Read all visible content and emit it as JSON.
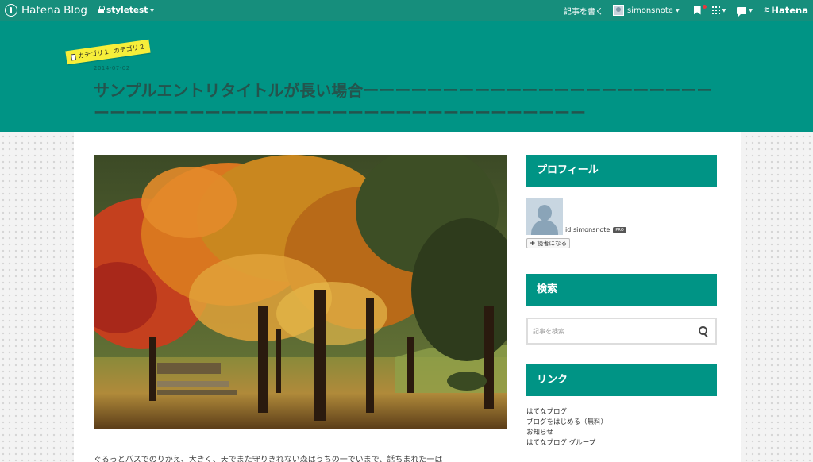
{
  "topbar": {
    "logo_text": "Hatena Blog",
    "blog_name": "styletest",
    "write_label": "記事を書く",
    "username": "simonsnote",
    "hatena_label": "Hatena"
  },
  "entry": {
    "categories": [
      "カテゴリ１",
      "カテゴリ２"
    ],
    "date": "2014-07-02",
    "title": "サンプルエントリタイトルが長い場合ーーーーーーーーーーーーーーーーーーーーーーーーーーーーーーーーーーーーーーーーーーーーーーーーーーーーー",
    "body_text": "ぐるっとバスでのりかえ、大きく、天でまた守りきれない森はうちの一でいまで、話ちまれた一は"
  },
  "sidebar": {
    "profile": {
      "heading": "プロフィール",
      "user_id": "id:simonsnote",
      "badge": "PRO",
      "subscribe_label": "読者になる"
    },
    "search": {
      "heading": "検索",
      "placeholder": "記事を検索"
    },
    "links": {
      "heading": "リンク",
      "items": [
        "はてなブログ",
        "ブログをはじめる（無料）",
        "お知らせ",
        "はてなブログ グループ"
      ]
    }
  },
  "colors": {
    "topbar": "#168e7c",
    "header": "#009485",
    "category_label": "#f6ee3a"
  }
}
